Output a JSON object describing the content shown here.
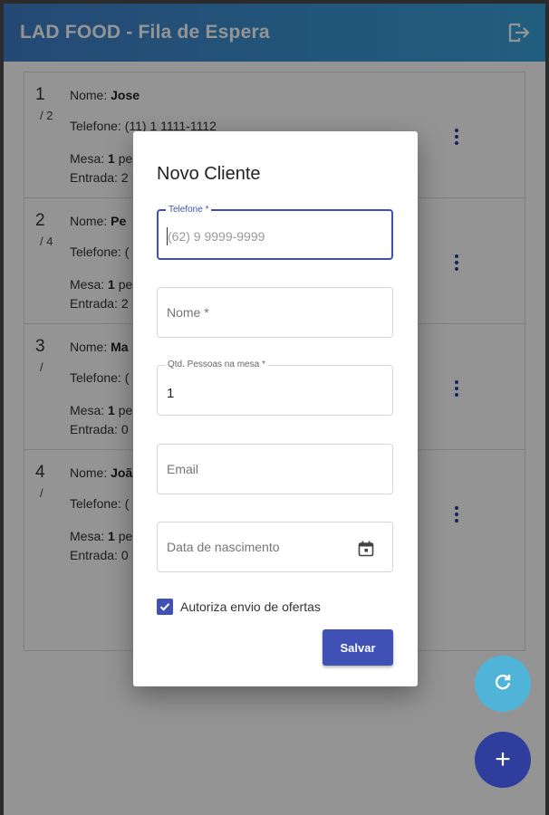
{
  "appbar": {
    "title": "LAD FOOD - Fila de Espera",
    "logout_icon": "logout-icon"
  },
  "queue": [
    {
      "position": "1",
      "sub": "/ 2",
      "name_label": "Nome:",
      "name": "Jose",
      "phone_label": "Telefone:",
      "phone": "(11) 1 1111-1112",
      "table_label": "Mesa:",
      "people": "1",
      "people_suffix": "pe",
      "entry_label": "Entrada:",
      "entry": "2"
    },
    {
      "position": "2",
      "sub": "/ 4",
      "name_label": "Nome:",
      "name": "Pe",
      "phone_label": "Telefone:",
      "phone": "(",
      "table_label": "Mesa:",
      "people": "1",
      "people_suffix": "pe",
      "entry_label": "Entrada:",
      "entry": "2"
    },
    {
      "position": "3",
      "sub": "/",
      "name_label": "Nome:",
      "name": "Ma",
      "phone_label": "Telefone:",
      "phone": "(",
      "table_label": "Mesa:",
      "people": "1",
      "people_suffix": "pe",
      "entry_label": "Entrada:",
      "entry": "0"
    },
    {
      "position": "4",
      "sub": "/",
      "name_label": "Nome:",
      "name": "Joã",
      "phone_label": "Telefone:",
      "phone": "(",
      "table_label": "Mesa:",
      "people": "1",
      "people_suffix": "pe",
      "entry_label": "Entrada:",
      "entry": "0"
    }
  ],
  "dialog": {
    "title": "Novo Cliente",
    "telefone": {
      "label": "Telefone *",
      "placeholder": "(62) 9 9999-9999",
      "value": ""
    },
    "nome": {
      "placeholder": "Nome *",
      "value": ""
    },
    "pessoas": {
      "label": "Qtd. Pessoas na mesa *",
      "value": "1"
    },
    "email": {
      "placeholder": "Email",
      "value": ""
    },
    "nascimento": {
      "placeholder": "Data de nascimento",
      "icon": "calendar-icon"
    },
    "ofertas": {
      "label": "Autoriza envio de ofertas",
      "checked": true
    },
    "save_label": "Salvar"
  },
  "fabs": {
    "refresh_icon": "refresh-icon",
    "add_icon": "add-icon",
    "add_glyph": "+"
  },
  "colors": {
    "primary": "#3f51b5",
    "appbar_start": "#3f7fc9",
    "appbar_end": "#3aa2da",
    "fab_refresh": "#4fb4d8",
    "fab_add": "#2f3d9c"
  }
}
